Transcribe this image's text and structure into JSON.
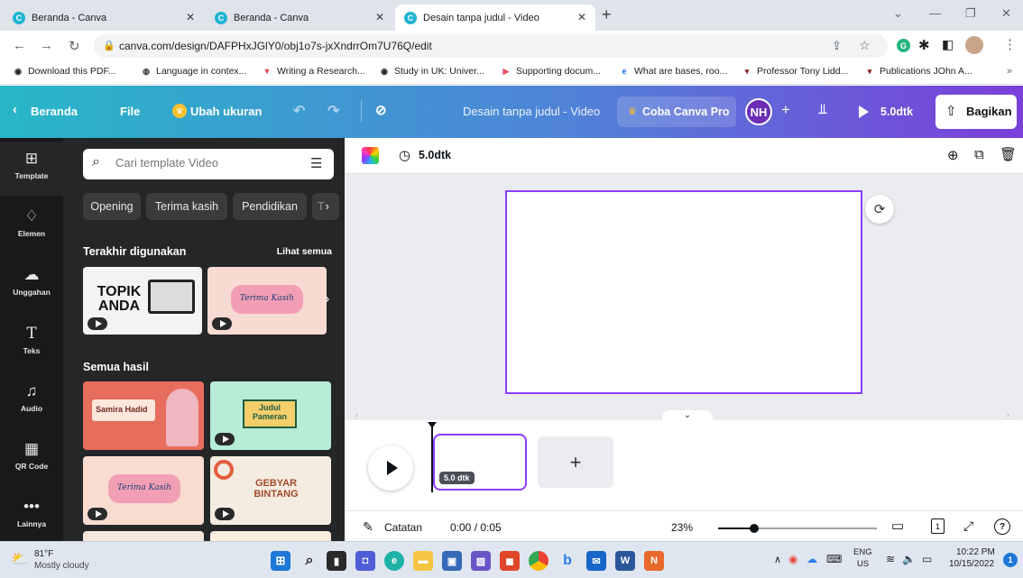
{
  "browser": {
    "tabs": [
      {
        "title": "Beranda - Canva",
        "active": false
      },
      {
        "title": "Beranda - Canva",
        "active": false
      },
      {
        "title": "Desain tanpa judul - Video",
        "active": true
      }
    ],
    "new_tab": "+",
    "url": "canva.com/design/DAFPHxJGlY0/obj1o7s-jxXndrrOm7U76Q/edit",
    "bookmarks": [
      {
        "label": "Download this PDF...",
        "icon": "globe-icon"
      },
      {
        "label": "Language in contex...",
        "icon": "site-icon"
      },
      {
        "label": "Writing a Research...",
        "icon": "bookmark-icon"
      },
      {
        "label": "Study in UK: Univer...",
        "icon": "globe-icon"
      },
      {
        "label": "Supporting docum...",
        "icon": "play-icon"
      },
      {
        "label": "What are bases, roo...",
        "icon": "e-icon"
      },
      {
        "label": "Professor Tony Lidd...",
        "icon": "site-icon"
      },
      {
        "label": "Publications JOhn A...",
        "icon": "site-icon"
      }
    ],
    "more_bookmarks": "»"
  },
  "header": {
    "back": "Beranda",
    "file": "File",
    "resize": "Ubah ukuran",
    "title": "Desain tanpa judul - Video",
    "pro": "Coba Canva Pro",
    "avatar_initials": "NH",
    "play_duration": "5.0dtk",
    "share": "Bagikan"
  },
  "rail": [
    {
      "label": "Template",
      "icon": "template-icon"
    },
    {
      "label": "Elemen",
      "icon": "elements-icon"
    },
    {
      "label": "Unggahan",
      "icon": "upload-icon"
    },
    {
      "label": "Teks",
      "icon": "text-icon"
    },
    {
      "label": "Audio",
      "icon": "music-icon"
    },
    {
      "label": "QR Code",
      "icon": "qr-icon"
    },
    {
      "label": "Lainnya",
      "icon": "more-icon"
    }
  ],
  "panel": {
    "search_placeholder": "Cari template Video",
    "chips": [
      "Opening",
      "Terima kasih",
      "Pendidikan",
      "T"
    ],
    "recent_title": "Terakhir digunakan",
    "see_all": "Lihat semua",
    "recent": [
      {
        "heading": "TOPIK ANDA"
      },
      {
        "heading": "Terima Kasih"
      }
    ],
    "results_title": "Semua hasil",
    "results": [
      {
        "heading": "Samira Hadid"
      },
      {
        "heading": "Judul Pameran"
      },
      {
        "heading": "Terima Kasih"
      },
      {
        "heading": "GEBYAR BINTANG"
      }
    ]
  },
  "editor": {
    "duration": "5.0dtk",
    "scene_duration": "5.0 dtk",
    "add_scene": "+",
    "notes": "Catatan",
    "time": "0:00 / 0:05",
    "zoom": "23%",
    "zoom_fraction": 0.23,
    "page_number": "1",
    "help": "?"
  },
  "taskbar": {
    "temperature": "81°F",
    "weather": "Mostly cloudy",
    "lang_1": "ENG",
    "lang_2": "US",
    "clock_time": "10:22 PM",
    "clock_date": "10/15/2022",
    "notif_count": "1"
  },
  "colors": {
    "accent": "#8b3dff",
    "header_start": "#27b7c7",
    "header_end": "#7b3fd9",
    "panel_bg": "#252627",
    "rail_bg": "#18191b"
  }
}
